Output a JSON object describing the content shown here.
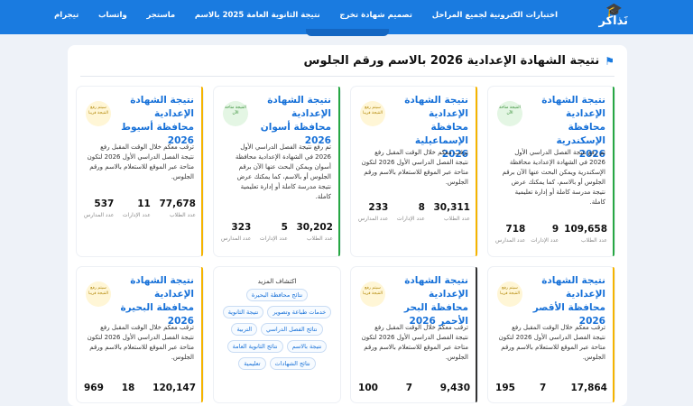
{
  "brand": {
    "name": "نَذاكر"
  },
  "nav": [
    "اختبارات الكترونية لجميع المراحل",
    "تصميم شهادة تخرج",
    "نتيجة الثانوية العامة 2025 بالاسم",
    "ماستجر",
    "واتساب",
    "تيجرام"
  ],
  "section_title": "نتيجة الشهادة الإعدادية 2026 بالاسم ورقم الجلوس",
  "labels": {
    "students": "عدد الطلاب",
    "admins": "عدد الإدارات",
    "schools": "عدد المدارس"
  },
  "colors": {
    "open": "#27a744",
    "soon": "#f5b400",
    "dark": "#333333"
  },
  "cards": [
    {
      "title": "نتيجة الشهادة الإعدادية محافظة الإسكندرية 2026",
      "badge": "النتيجة متاحة الآن",
      "desc": "تم رفع نتيجة الفصل الدراسي الأول 2026 في الشهادة الإعدادية محافظة الإسكندرية ويمكن البحث عنها الآن برقم الجلوس أو بالاسم، كما يمكنك عرض نتيجة مدرسة كاملة أو إدارة تعليمية كاملة.",
      "students": "109,658",
      "admins": "9",
      "schools": "718"
    },
    {
      "title": "نتيجة الشهادة الإعدادية محافظة الإسماعيلية 2026",
      "badge": "سيتم رفع النتيجة قريبا",
      "desc": "ترقب معكم خلال الوقت المقبل رفع نتيجة الفصل الدراسي الأول 2026 لتكون متاحة عبر الموقع للاستعلام بالاسم ورقم الجلوس.",
      "students": "30,311",
      "admins": "8",
      "schools": "233"
    },
    {
      "title": "نتيجة الشهادة الإعدادية محافظة أسوان 2026",
      "badge": "النتيجة متاحة الآن",
      "desc": "تم رفع نتيجة الفصل الدراسي الأول 2026 في الشهادة الإعدادية محافظة أسوان ويمكن البحث عنها الآن برقم الجلوس أو بالاسم، كما يمكنك عرض نتيجة مدرسة كاملة أو إدارة تعليمية كاملة.",
      "students": "30,202",
      "admins": "5",
      "schools": "323"
    },
    {
      "title": "نتيجة الشهادة الإعدادية محافظة أسيوط 2026",
      "badge": "سيتم رفع النتيجة قريبا",
      "desc": "ترقب معكم خلال الوقت المقبل رفع نتيجة الفصل الدراسي الأول 2026 لتكون متاحة عبر الموقع للاستعلام بالاسم ورقم الجلوس.",
      "students": "77,678",
      "admins": "11",
      "schools": "537"
    },
    {
      "title": "نتيجة الشهادة الإعدادية محافظة الأقصر 2026",
      "badge": "سيتم رفع النتيجة قريبا",
      "desc": "ترقب معكم خلال الوقت المقبل رفع نتيجة الفصل الدراسي الأول 2026 لتكون متاحة عبر الموقع للاستعلام بالاسم ورقم الجلوس.",
      "students": "17,864",
      "admins": "7",
      "schools": "195"
    },
    {
      "title": "نتيجة الشهادة الإعدادية محافظة البحر الأحمر 2026",
      "badge": "سيتم رفع النتيجة قريبا",
      "desc": "ترقب معكم خلال الوقت المقبل رفع نتيجة الفصل الدراسي الأول 2026 لتكون متاحة عبر الموقع للاستعلام بالاسم ورقم الجلوس.",
      "students": "9,430",
      "admins": "7",
      "schools": "100"
    },
    {
      "title": "نتيجة الشهادة الإعدادية محافظة البحيرة 2026",
      "badge": "سيتم رفع النتيجة قريبا",
      "desc": "ترقب معكم خلال الوقت المقبل رفع نتيجة الفصل الدراسي الأول 2026 لتكون متاحة عبر الموقع للاستعلام بالاسم ورقم الجلوس.",
      "students": "120,147",
      "admins": "18",
      "schools": "969"
    }
  ],
  "explore": {
    "title": "اكتشاف المزيد",
    "chips": [
      "نتائج محافظة البحيرة",
      "خدمات طباعة وتصوير",
      "نتيجة الثانوية",
      "نتائج الفصل الدراسي",
      "التربية",
      "نتيجة بالاسم",
      "نتائج الثانوية العامة",
      "نتائج الشهادات",
      "تعليمية"
    ]
  }
}
